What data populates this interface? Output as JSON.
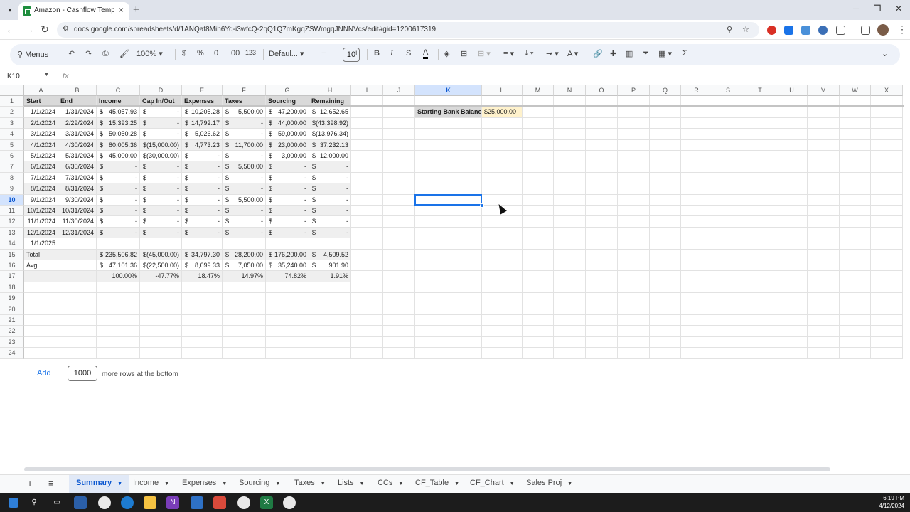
{
  "browser": {
    "tab_title": "Amazon - Cashflow Template -",
    "url": "docs.google.com/spreadsheets/d/1ANQaf8Mih6Yq-i3wfcQ-2qQ1Q7mKgqZSWmgqJNNNVcs/edit#gid=1200617319",
    "close_glyph": "×",
    "newtab_glyph": "+"
  },
  "toolbar": {
    "menus_label": "Menus",
    "zoom": "100%",
    "currency": "$",
    "percent": "%",
    "dec_less": ".0",
    "dec_more": ".00",
    "number_format": "123",
    "font": "Defaul...",
    "font_size": "10"
  },
  "formula_bar": {
    "name_box": "K10",
    "fx": "fx"
  },
  "columns": [
    "A",
    "B",
    "C",
    "D",
    "E",
    "F",
    "G",
    "H",
    "I",
    "J",
    "K",
    "L",
    "M",
    "N",
    "O",
    "P",
    "Q",
    "R",
    "S",
    "T",
    "U",
    "V",
    "W",
    "X"
  ],
  "selected_column": "K",
  "selected_row": 10,
  "headers": [
    "Start",
    "End",
    "Income",
    "Cap In/Out",
    "Expenses",
    "Taxes",
    "Sourcing",
    "Remaining"
  ],
  "rows": [
    {
      "start": "1/1/2024",
      "end": "1/31/2024",
      "income": "45,057.93",
      "cap": "-",
      "expenses": "10,205.28",
      "taxes": "5,500.00",
      "sourcing": "47,200.00",
      "remaining": "12,652.65"
    },
    {
      "start": "2/1/2024",
      "end": "2/29/2024",
      "income": "15,393.25",
      "cap": "-",
      "expenses": "14,792.17",
      "taxes": "-",
      "sourcing": "44,000.00",
      "remaining": "(43,398.92)"
    },
    {
      "start": "3/1/2024",
      "end": "3/31/2024",
      "income": "50,050.28",
      "cap": "-",
      "expenses": "5,026.62",
      "taxes": "-",
      "sourcing": "59,000.00",
      "remaining": "(13,976.34)"
    },
    {
      "start": "4/1/2024",
      "end": "4/30/2024",
      "income": "80,005.36",
      "cap": "(15,000.00)",
      "expenses": "4,773.23",
      "taxes": "11,700.00",
      "sourcing": "23,000.00",
      "remaining": "37,232.13"
    },
    {
      "start": "5/1/2024",
      "end": "5/31/2024",
      "income": "45,000.00",
      "cap": "(30,000.00)",
      "expenses": "-",
      "taxes": "-",
      "sourcing": "3,000.00",
      "remaining": "12,000.00"
    },
    {
      "start": "6/1/2024",
      "end": "6/30/2024",
      "income": "-",
      "cap": "-",
      "expenses": "-",
      "taxes": "5,500.00",
      "sourcing": "-",
      "remaining": "-"
    },
    {
      "start": "7/1/2024",
      "end": "7/31/2024",
      "income": "-",
      "cap": "-",
      "expenses": "-",
      "taxes": "-",
      "sourcing": "-",
      "remaining": "-"
    },
    {
      "start": "8/1/2024",
      "end": "8/31/2024",
      "income": "-",
      "cap": "-",
      "expenses": "-",
      "taxes": "-",
      "sourcing": "-",
      "remaining": "-"
    },
    {
      "start": "9/1/2024",
      "end": "9/30/2024",
      "income": "-",
      "cap": "-",
      "expenses": "-",
      "taxes": "5,500.00",
      "sourcing": "-",
      "remaining": "-"
    },
    {
      "start": "10/1/2024",
      "end": "10/31/2024",
      "income": "-",
      "cap": "-",
      "expenses": "-",
      "taxes": "-",
      "sourcing": "-",
      "remaining": "-"
    },
    {
      "start": "11/1/2024",
      "end": "11/30/2024",
      "income": "-",
      "cap": "-",
      "expenses": "-",
      "taxes": "-",
      "sourcing": "-",
      "remaining": "-"
    },
    {
      "start": "12/1/2024",
      "end": "12/31/2024",
      "income": "-",
      "cap": "-",
      "expenses": "-",
      "taxes": "-",
      "sourcing": "-",
      "remaining": "-"
    }
  ],
  "row14_start": "1/1/2025",
  "total": {
    "label": "Total",
    "income": "235,506.82",
    "cap": "(45,000.00)",
    "expenses": "34,797.30",
    "taxes": "28,200.00",
    "sourcing": "176,200.00",
    "remaining": "4,509.52"
  },
  "avg": {
    "label": "Avg",
    "income": "47,101.36",
    "cap": "(22,500.00)",
    "expenses": "8,699.33",
    "taxes": "7,050.00",
    "sourcing": "35,240.00",
    "remaining": "901.90"
  },
  "pct": {
    "income": "100.00%",
    "cap": "-47.77%",
    "expenses": "18.47%",
    "taxes": "14.97%",
    "sourcing": "74.82%",
    "remaining": "1.91%"
  },
  "bank": {
    "label": "Starting Bank Balance",
    "value": "$25,000.00"
  },
  "add_rows": {
    "button": "Add",
    "count": "1000",
    "text": "more rows at the bottom"
  },
  "sheet_tabs": [
    "Summary",
    "Income",
    "Expenses",
    "Sourcing",
    "Taxes",
    "Lists",
    "CCs",
    "CF_Table",
    "CF_Chart",
    "Sales Proj"
  ],
  "active_sheet": "Summary",
  "clock": {
    "time": "6:19 PM",
    "date": "4/12/2024"
  },
  "colors": {
    "selection": "#1a73e8",
    "highlight": "#fff2cc",
    "header_fill": "#d9d9d9",
    "band_fill": "#efefef",
    "sheets_green": "#1e8e3e"
  }
}
